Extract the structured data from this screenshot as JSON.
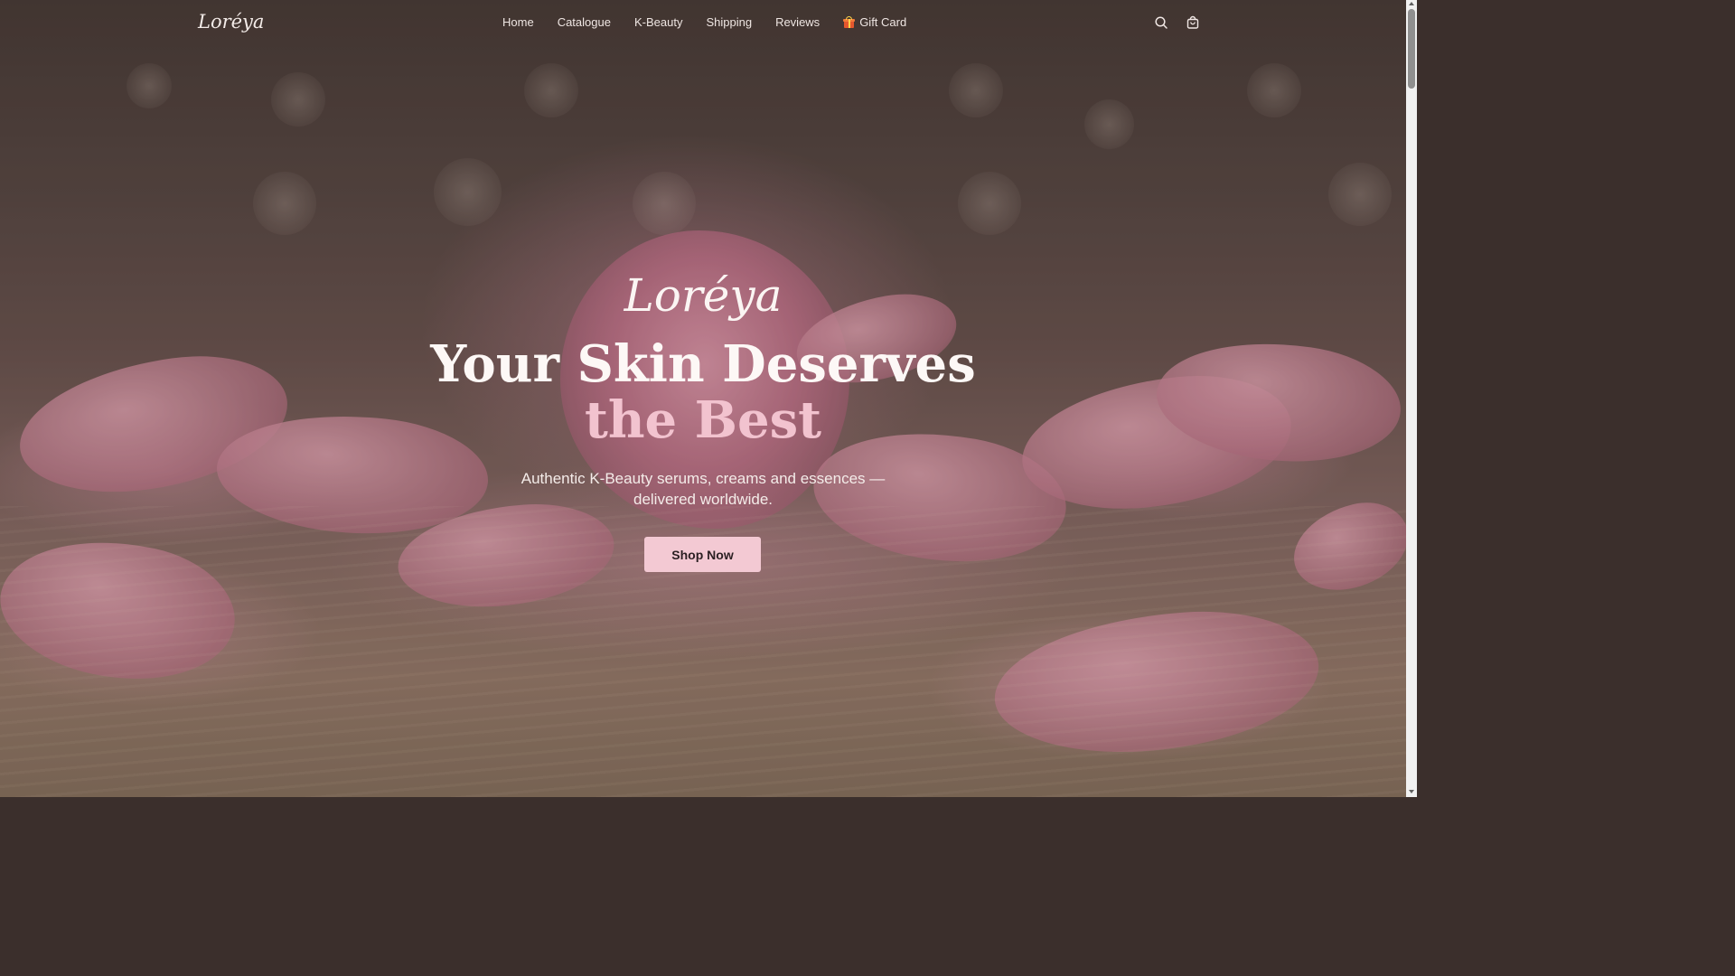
{
  "brand": {
    "logo": "Loréya"
  },
  "nav": {
    "links": [
      {
        "label": "Home"
      },
      {
        "label": "Catalogue"
      },
      {
        "label": "K-Beauty"
      },
      {
        "label": "Shipping"
      },
      {
        "label": "Reviews"
      },
      {
        "label": "Gift Card",
        "icon": "gift-icon"
      }
    ],
    "icons": [
      "search-icon",
      "shopping-bag-icon"
    ]
  },
  "hero": {
    "logo": "Loréya",
    "title_line1": "Your Skin Deserves",
    "title_line2": "the Best",
    "subtitle": "Authentic K-Beauty serums, creams and essences — delivered worldwide.",
    "cta_label": "Shop Now"
  },
  "colors": {
    "accent": "#f2c3cf",
    "button_bg": "#f3c9d3",
    "text_light": "#fdf8f6"
  }
}
